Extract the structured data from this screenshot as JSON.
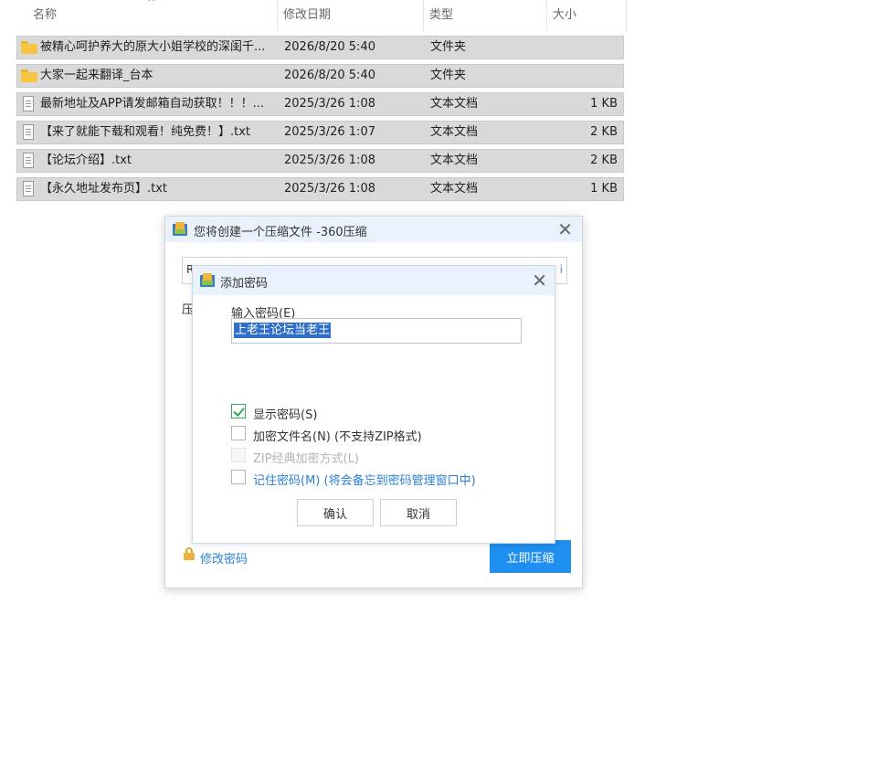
{
  "explorer": {
    "columns": {
      "name": "名称",
      "date": "修改日期",
      "type": "类型",
      "size": "大小"
    },
    "sort_indicator": "^",
    "rows": [
      {
        "kind": "folder",
        "name": "被精心呵护养大的原大小姐学校的深闺千...",
        "date": "2026/8/20 5:40",
        "type": "文件夹",
        "size": ""
      },
      {
        "kind": "folder",
        "name": "大家一起来翻译_台本",
        "date": "2026/8/20 5:40",
        "type": "文件夹",
        "size": ""
      },
      {
        "kind": "file",
        "name": "最新地址及APP请发邮箱自动获取！！！...",
        "date": "2025/3/26 1:08",
        "type": "文本文档",
        "size": "1 KB"
      },
      {
        "kind": "file",
        "name": "【来了就能下载和观看！纯免费！】.txt",
        "date": "2025/3/26 1:07",
        "type": "文本文档",
        "size": "2 KB"
      },
      {
        "kind": "file",
        "name": "【论坛介绍】.txt",
        "date": "2025/3/26 1:08",
        "type": "文本文档",
        "size": "2 KB"
      },
      {
        "kind": "file",
        "name": "【永久地址发布页】.txt",
        "date": "2025/3/26 1:08",
        "type": "文本文档",
        "size": "1 KB"
      }
    ]
  },
  "compress_dialog": {
    "title": "您将创建一个压缩文件 -360压缩",
    "path_left": "R",
    "path_right": "i",
    "side_label": "压",
    "change_password": "修改密码",
    "compress_now": "立即压缩",
    "close": "✕"
  },
  "password_dialog": {
    "title": "添加密码",
    "close": "✕",
    "password_label": "输入密码(E)",
    "password_value": "上老王论坛当老王",
    "options": [
      {
        "label": "显示密码(S)",
        "checked": true,
        "disabled": false,
        "link": false
      },
      {
        "label": "加密文件名(N) (不支持ZIP格式)",
        "checked": false,
        "disabled": false,
        "link": false
      },
      {
        "label": "ZIP经典加密方式(L)",
        "checked": false,
        "disabled": true,
        "link": false
      },
      {
        "label": "记住密码(M) (将会备忘到密码管理窗口中)",
        "checked": false,
        "disabled": false,
        "link": true
      }
    ],
    "ok": "确认",
    "cancel": "取消"
  }
}
